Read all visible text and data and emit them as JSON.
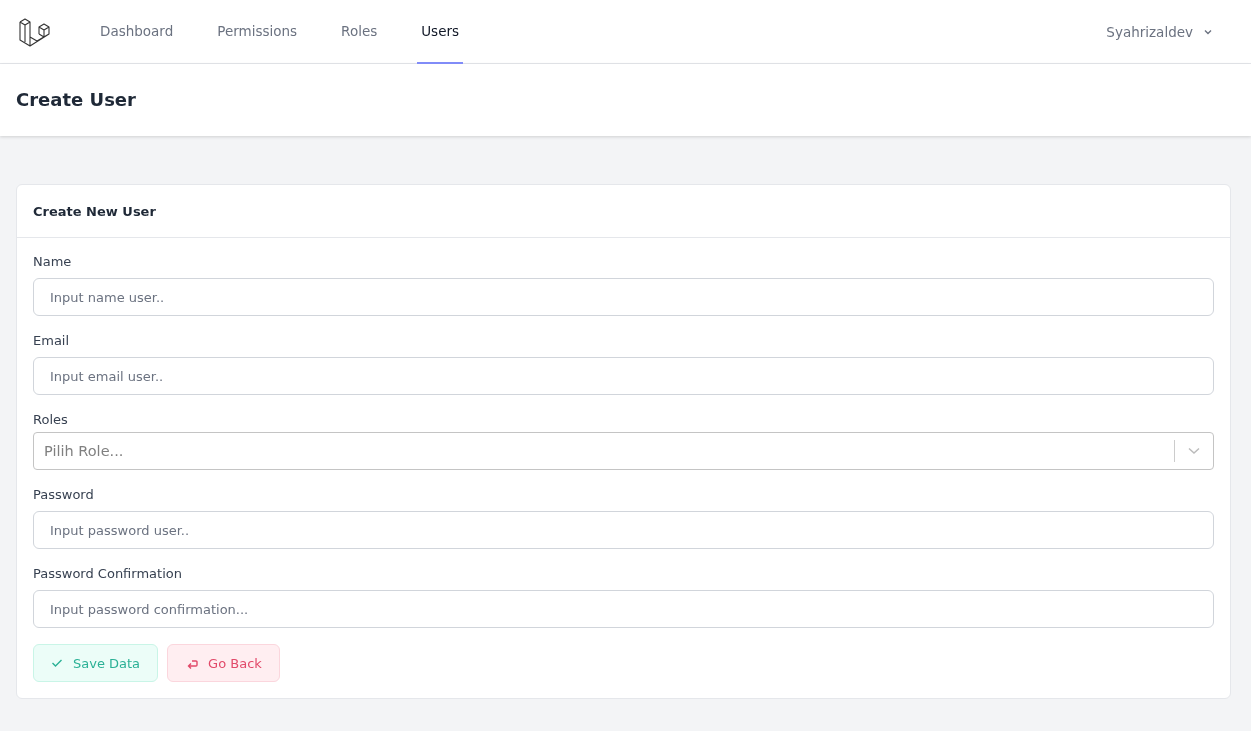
{
  "nav": {
    "items": [
      {
        "label": "Dashboard",
        "selected": false
      },
      {
        "label": "Permissions",
        "selected": false
      },
      {
        "label": "Roles",
        "selected": false
      },
      {
        "label": "Users",
        "selected": true
      }
    ],
    "user": "Syahrizaldev"
  },
  "header": {
    "title": "Create User"
  },
  "card": {
    "title": "Create New User",
    "fields": [
      {
        "kind": "input",
        "label": "Name",
        "placeholder": "Input name user.."
      },
      {
        "kind": "input",
        "label": "Email",
        "placeholder": "Input email user.."
      },
      {
        "kind": "select",
        "label": "Roles",
        "placeholder": "Pilih Role..."
      },
      {
        "kind": "input",
        "label": "Password",
        "placeholder": "Input password user.."
      },
      {
        "kind": "input",
        "label": "Password Confirmation",
        "placeholder": "Input password confirmation..."
      }
    ],
    "buttons": [
      {
        "kind": "save",
        "label": "Save Data"
      },
      {
        "kind": "back",
        "label": "Go Back"
      }
    ]
  }
}
